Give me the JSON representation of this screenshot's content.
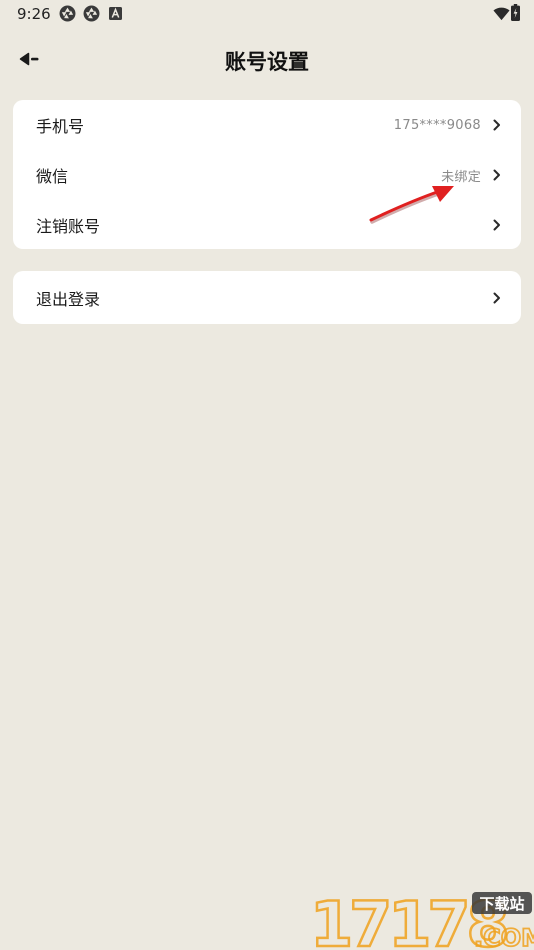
{
  "status_bar": {
    "time": "9:26",
    "icons": [
      "aperture-icon",
      "aperture-icon",
      "a-badge-icon",
      "wifi-icon",
      "battery-icon"
    ]
  },
  "header": {
    "title": "账号设置",
    "back_icon": "back-arrow-icon"
  },
  "account_card": {
    "rows": [
      {
        "label": "手机号",
        "value": "175****9068"
      },
      {
        "label": "微信",
        "value": "未绑定"
      },
      {
        "label": "注销账号",
        "value": ""
      }
    ]
  },
  "logout_card": {
    "label": "退出登录"
  },
  "watermark": {
    "logo_text": "17178",
    "tag": "下载站",
    "domain": ".COM"
  },
  "colors": {
    "background": "#ECE9E0",
    "card": "#FFFFFF",
    "annotation": "#E02020",
    "watermark_orange": "#F0A21E"
  }
}
